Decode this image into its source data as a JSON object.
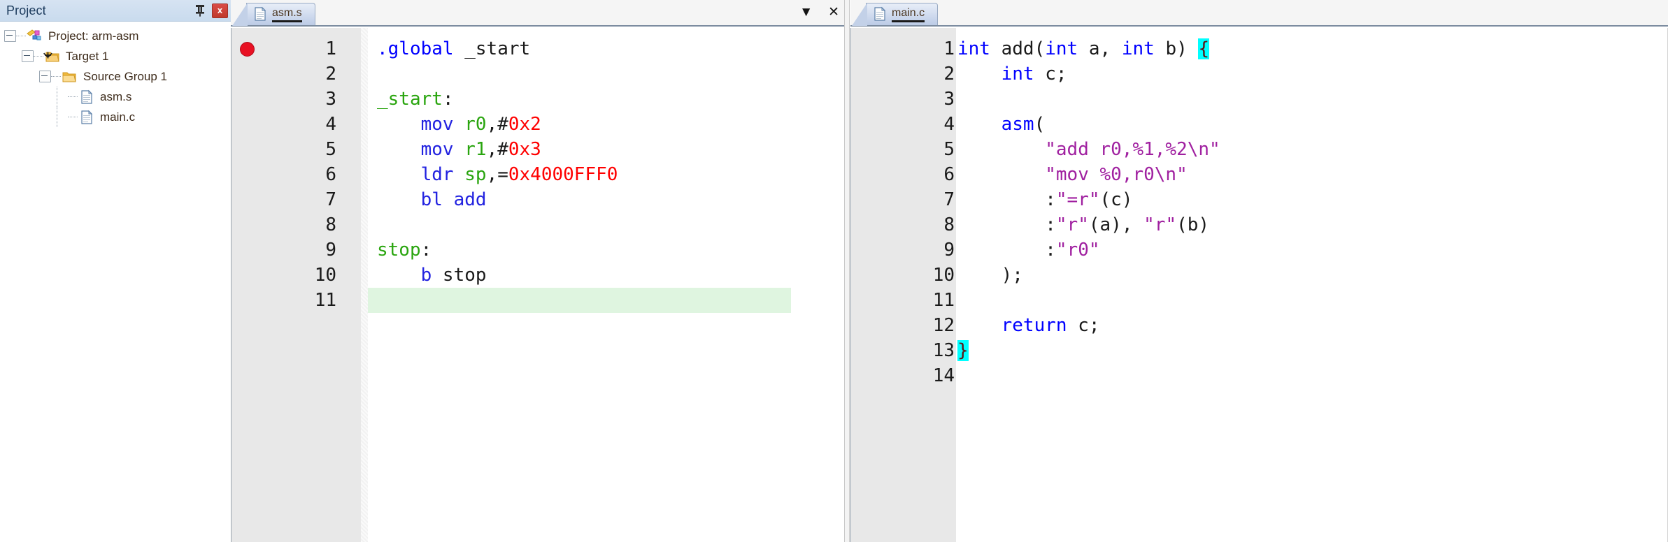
{
  "project_panel": {
    "title": "Project",
    "pin_icon": "pin-icon",
    "close_label": "x",
    "tree": [
      {
        "label": "Project: arm-asm",
        "icon": "project-icon",
        "depth": 0,
        "expandable": true,
        "name": "tree-item-project"
      },
      {
        "label": "Target 1",
        "icon": "target-folder-icon",
        "depth": 1,
        "expandable": true,
        "name": "tree-item-target-1"
      },
      {
        "label": "Source Group 1",
        "icon": "folder-icon",
        "depth": 2,
        "expandable": true,
        "name": "tree-item-source-group-1"
      },
      {
        "label": "asm.s",
        "icon": "file-icon",
        "depth": 3,
        "expandable": false,
        "name": "tree-item-asm-s"
      },
      {
        "label": "main.c",
        "icon": "file-icon",
        "depth": 3,
        "expandable": false,
        "name": "tree-item-main-c"
      }
    ]
  },
  "editors": [
    {
      "id": "asm",
      "tab_label": "asm.s",
      "tab_icon": "file-icon",
      "tools": [
        {
          "glyph": "▼",
          "name": "tab-list-dropdown"
        },
        {
          "glyph": "✕",
          "name": "close-document-button"
        }
      ],
      "breakpoint_line": 1,
      "highlight_line": 11,
      "lines": [
        {
          "n": 1,
          "tokens": [
            {
              "t": ".global",
              "c": "tok-key"
            },
            {
              "t": " _start",
              "c": "tok-plain"
            }
          ]
        },
        {
          "n": 2,
          "tokens": []
        },
        {
          "n": 3,
          "tokens": [
            {
              "t": "_start",
              "c": "tok-label"
            },
            {
              "t": ":",
              "c": "tok-plain"
            }
          ]
        },
        {
          "n": 4,
          "tokens": [
            {
              "t": "    ",
              "c": "tok-plain"
            },
            {
              "t": "mov",
              "c": "tok-mnem"
            },
            {
              "t": " ",
              "c": "tok-plain"
            },
            {
              "t": "r0",
              "c": "tok-reg"
            },
            {
              "t": ",#",
              "c": "tok-plain"
            },
            {
              "t": "0x2",
              "c": "tok-num"
            }
          ]
        },
        {
          "n": 5,
          "tokens": [
            {
              "t": "    ",
              "c": "tok-plain"
            },
            {
              "t": "mov",
              "c": "tok-mnem"
            },
            {
              "t": " ",
              "c": "tok-plain"
            },
            {
              "t": "r1",
              "c": "tok-reg"
            },
            {
              "t": ",#",
              "c": "tok-plain"
            },
            {
              "t": "0x3",
              "c": "tok-num"
            }
          ]
        },
        {
          "n": 6,
          "tokens": [
            {
              "t": "    ",
              "c": "tok-plain"
            },
            {
              "t": "ldr",
              "c": "tok-mnem"
            },
            {
              "t": " ",
              "c": "tok-plain"
            },
            {
              "t": "sp",
              "c": "tok-reg"
            },
            {
              "t": ",=",
              "c": "tok-plain"
            },
            {
              "t": "0x4000FFF0",
              "c": "tok-num"
            }
          ]
        },
        {
          "n": 7,
          "tokens": [
            {
              "t": "    ",
              "c": "tok-plain"
            },
            {
              "t": "bl add",
              "c": "tok-mnem"
            }
          ]
        },
        {
          "n": 8,
          "tokens": []
        },
        {
          "n": 9,
          "tokens": [
            {
              "t": "stop",
              "c": "tok-label"
            },
            {
              "t": ":",
              "c": "tok-plain"
            }
          ]
        },
        {
          "n": 10,
          "tokens": [
            {
              "t": "    ",
              "c": "tok-plain"
            },
            {
              "t": "b",
              "c": "tok-mnem"
            },
            {
              "t": " stop",
              "c": "tok-plain"
            }
          ]
        },
        {
          "n": 11,
          "tokens": []
        }
      ]
    },
    {
      "id": "main",
      "tab_label": "main.c",
      "tab_icon": "file-icon",
      "tools": [],
      "breakpoint_line": 0,
      "highlight_line": 0,
      "lines": [
        {
          "n": 1,
          "tokens": [
            {
              "t": "int",
              "c": "tok-key"
            },
            {
              "t": " add(",
              "c": "tok-plain"
            },
            {
              "t": "int",
              "c": "tok-key"
            },
            {
              "t": " a, ",
              "c": "tok-plain"
            },
            {
              "t": "int",
              "c": "tok-key"
            },
            {
              "t": " b) ",
              "c": "tok-plain"
            },
            {
              "t": "{",
              "c": "tok-brace-hl"
            }
          ]
        },
        {
          "n": 2,
          "tokens": [
            {
              "t": "    ",
              "c": "tok-plain"
            },
            {
              "t": "int",
              "c": "tok-key"
            },
            {
              "t": " c;",
              "c": "tok-plain"
            }
          ]
        },
        {
          "n": 3,
          "tokens": []
        },
        {
          "n": 4,
          "tokens": [
            {
              "t": "    ",
              "c": "tok-plain"
            },
            {
              "t": "asm",
              "c": "tok-key"
            },
            {
              "t": "(",
              "c": "tok-plain"
            }
          ]
        },
        {
          "n": 5,
          "tokens": [
            {
              "t": "        ",
              "c": "tok-plain"
            },
            {
              "t": "\"add r0,%1,%2\\n\"",
              "c": "tok-str"
            }
          ]
        },
        {
          "n": 6,
          "tokens": [
            {
              "t": "        ",
              "c": "tok-plain"
            },
            {
              "t": "\"mov %0,r0\\n\"",
              "c": "tok-str"
            }
          ]
        },
        {
          "n": 7,
          "tokens": [
            {
              "t": "        ",
              "c": "tok-plain"
            },
            {
              "t": ":",
              "c": "tok-plain"
            },
            {
              "t": "\"=r\"",
              "c": "tok-str"
            },
            {
              "t": "(c)",
              "c": "tok-plain"
            }
          ]
        },
        {
          "n": 8,
          "tokens": [
            {
              "t": "        ",
              "c": "tok-plain"
            },
            {
              "t": ":",
              "c": "tok-plain"
            },
            {
              "t": "\"r\"",
              "c": "tok-str"
            },
            {
              "t": "(a), ",
              "c": "tok-plain"
            },
            {
              "t": "\"r\"",
              "c": "tok-str"
            },
            {
              "t": "(b)",
              "c": "tok-plain"
            }
          ]
        },
        {
          "n": 9,
          "tokens": [
            {
              "t": "        ",
              "c": "tok-plain"
            },
            {
              "t": ":",
              "c": "tok-plain"
            },
            {
              "t": "\"r0\"",
              "c": "tok-str"
            }
          ]
        },
        {
          "n": 10,
          "tokens": [
            {
              "t": "    );",
              "c": "tok-plain"
            }
          ]
        },
        {
          "n": 11,
          "tokens": []
        },
        {
          "n": 12,
          "tokens": [
            {
              "t": "    ",
              "c": "tok-plain"
            },
            {
              "t": "return",
              "c": "tok-key"
            },
            {
              "t": " c;",
              "c": "tok-plain"
            }
          ]
        },
        {
          "n": 13,
          "tokens": [
            {
              "t": "}",
              "c": "tok-brace-hl"
            }
          ]
        },
        {
          "n": 14,
          "tokens": []
        }
      ]
    }
  ],
  "colors": {
    "keyword": "#0000ff",
    "register": "#2aa50f",
    "number": "#ff0000",
    "string": "#a020a0",
    "brace_match_bg": "#00ffff",
    "current_line_bg": "#dff5e0",
    "breakpoint": "#e81123",
    "tab_active": "#bccbe6",
    "panel_header": "#c9dbee"
  }
}
